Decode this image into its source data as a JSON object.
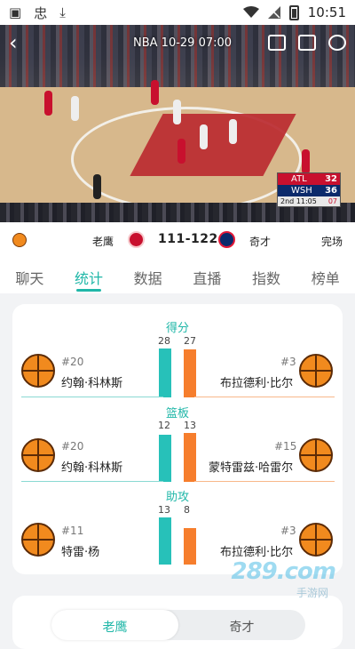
{
  "status_bar": {
    "time": "10:51"
  },
  "video": {
    "title": "NBA 10-29 07:00",
    "scorebug": {
      "teams": [
        {
          "abbr": "ATL",
          "score": "32"
        },
        {
          "abbr": "WSH",
          "score": "36"
        }
      ],
      "period": "2nd 11:05",
      "shot_clock": "07"
    }
  },
  "match": {
    "home": "老鹰",
    "score": "111-122",
    "away": "奇才",
    "status": "完场"
  },
  "tabs": [
    "聊天",
    "统计",
    "数据",
    "直播",
    "指数",
    "榜单"
  ],
  "active_tab": "统计",
  "leaders": [
    {
      "title": "得分",
      "left": {
        "number": "#20",
        "name": "约翰·科林斯",
        "value": "28"
      },
      "right": {
        "number": "#3",
        "name": "布拉德利·比尔",
        "value": "27"
      }
    },
    {
      "title": "篮板",
      "left": {
        "number": "#20",
        "name": "约翰·科林斯",
        "value": "12"
      },
      "right": {
        "number": "#15",
        "name": "蒙特雷兹·哈雷尔",
        "value": "13"
      }
    },
    {
      "title": "助攻",
      "left": {
        "number": "#11",
        "name": "特雷·杨",
        "value": "13"
      },
      "right": {
        "number": "#3",
        "name": "布拉德利·比尔",
        "value": "8"
      }
    }
  ],
  "team_toggle": {
    "home": "老鹰",
    "away": "奇才"
  },
  "watermark": {
    "main": "289.com",
    "sub": "手游网"
  },
  "colors": {
    "accent": "#20b7a8",
    "home_bar": "#27c1b9",
    "away_bar": "#f67e2d"
  }
}
